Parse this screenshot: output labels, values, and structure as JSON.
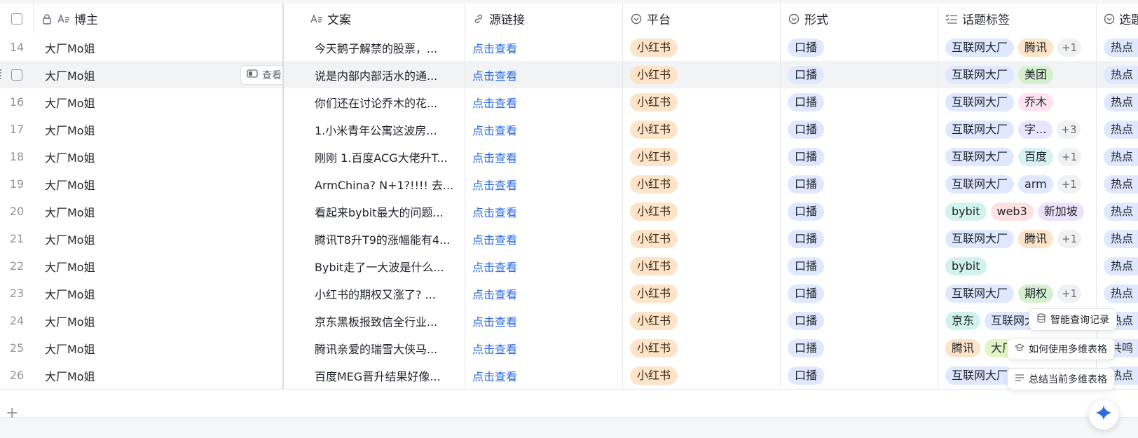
{
  "headers": {
    "blogger": "博主",
    "copy": "文案",
    "source_link": "源链接",
    "platform": "平台",
    "format": "形式",
    "topic_tags": "话题标签",
    "selected": "选题"
  },
  "hover_row": {
    "view_label": "查看"
  },
  "rows": [
    {
      "num": "14",
      "name": "大厂Mo姐",
      "copy": "今天鹅子解禁的股票，...",
      "link": "点击查看",
      "platform": "小红书",
      "format": "口播",
      "tags": [
        "互联网大厂",
        "腾讯"
      ],
      "more": "+1",
      "sel": "热点"
    },
    {
      "num": "",
      "name": "大厂Mo姐",
      "copy": "说是内部内部活水的通...",
      "link": "点击查看",
      "platform": "小红书",
      "format": "口播",
      "tags": [
        "互联网大厂",
        "美团"
      ],
      "more": "",
      "sel": "热点"
    },
    {
      "num": "16",
      "name": "大厂Mo姐",
      "copy": "你们还在讨论乔木的花...",
      "link": "点击查看",
      "platform": "小红书",
      "format": "口播",
      "tags": [
        "互联网大厂",
        "乔木"
      ],
      "more": "",
      "sel": "热点"
    },
    {
      "num": "17",
      "name": "大厂Mo姐",
      "copy": "1.小米青年公寓这波房...",
      "link": "点击查看",
      "platform": "小红书",
      "format": "口播",
      "tags": [
        "互联网大厂",
        "字..."
      ],
      "more": "+3",
      "sel": "热点"
    },
    {
      "num": "18",
      "name": "大厂Mo姐",
      "copy": "刚刚 1.百度ACG大佬升T...",
      "link": "点击查看",
      "platform": "小红书",
      "format": "口播",
      "tags": [
        "互联网大厂",
        "百度"
      ],
      "more": "+1",
      "sel": "热点"
    },
    {
      "num": "19",
      "name": "大厂Mo姐",
      "copy": "ArmChina? N+1?!!!! 去...",
      "link": "点击查看",
      "platform": "小红书",
      "format": "口播",
      "tags": [
        "互联网大厂",
        "arm"
      ],
      "more": "+1",
      "sel": "热点"
    },
    {
      "num": "20",
      "name": "大厂Mo姐",
      "copy": "看起来bybit最大的问题...",
      "link": "点击查看",
      "platform": "小红书",
      "format": "口播",
      "tags": [
        "bybit",
        "web3",
        "新加坡"
      ],
      "more": "",
      "sel": "热点"
    },
    {
      "num": "21",
      "name": "大厂Mo姐",
      "copy": "腾讯T8升T9的涨幅能有4...",
      "link": "点击查看",
      "platform": "小红书",
      "format": "口播",
      "tags": [
        "互联网大厂",
        "腾讯"
      ],
      "more": "+1",
      "sel": "热点"
    },
    {
      "num": "22",
      "name": "大厂Mo姐",
      "copy": "Bybit走了一大波是什么...",
      "link": "点击查看",
      "platform": "小红书",
      "format": "口播",
      "tags": [
        "bybit"
      ],
      "more": "",
      "sel": "热点"
    },
    {
      "num": "23",
      "name": "大厂Mo姐",
      "copy": "小红书的期权又涨了? ...",
      "link": "点击查看",
      "platform": "小红书",
      "format": "口播",
      "tags": [
        "互联网大厂",
        "期权"
      ],
      "more": "+1",
      "sel": "热点"
    },
    {
      "num": "24",
      "name": "大厂Mo姐",
      "copy": "京东黑板报致信全行业...",
      "link": "点击查看",
      "platform": "小红书",
      "format": "口播",
      "tags": [
        "京东",
        "互联网大厂"
      ],
      "more": "",
      "sel": "热点"
    },
    {
      "num": "25",
      "name": "大厂Mo姐",
      "copy": "腾讯亲爱的瑞雪大侠马...",
      "link": "点击查看",
      "platform": "小红书",
      "format": "口播",
      "tags": [
        "腾讯",
        "大厂"
      ],
      "more": "",
      "sel": "共鸣"
    },
    {
      "num": "26",
      "name": "大厂Mo姐",
      "copy": "百度MEG晋升结果好像...",
      "link": "点击查看",
      "platform": "小红书",
      "format": "口播",
      "tags": [
        "互联网大厂"
      ],
      "more": "",
      "sel": "热点"
    }
  ],
  "floating_menu": {
    "smart_query": "智能查询记录",
    "how_to_use": "如何使用多维表格",
    "summarize": "总结当前多维表格"
  },
  "colors": {
    "link": "#2a6ae9",
    "platform_pill": "#fde4c8",
    "format_pill": "#dfe8ff",
    "tag_palette": {
      "互联网大厂": "#dfe8ff",
      "腾讯": "#fde4c8",
      "美团": "#d5f0cf",
      "乔木": "#fde2ef",
      "字...": "#e9e4ff",
      "百度": "#d6f2f4",
      "arm": "#dfe8ff",
      "bybit": "#d2f3ec",
      "web3": "#fde1e1",
      "新加坡": "#eee2fb",
      "期权": "#d5f0cf",
      "京东": "#d2f3ec",
      "大厂": "#e3f4c6"
    }
  }
}
